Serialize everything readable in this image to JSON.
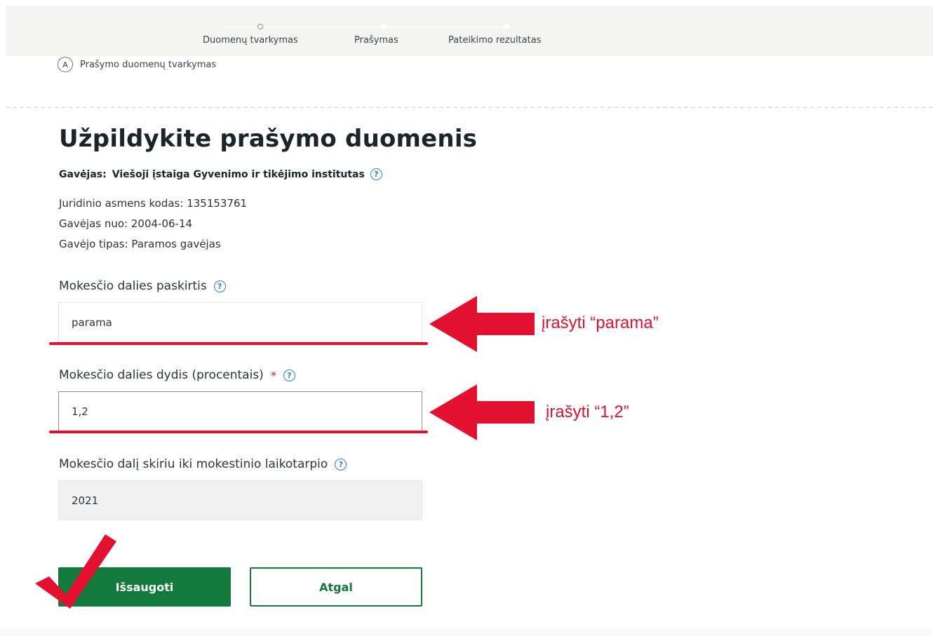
{
  "stepper": {
    "steps": [
      {
        "label": "Duomenų tvarkymas",
        "state": "current"
      },
      {
        "label": "Prašymas",
        "state": "upcoming"
      },
      {
        "label": "Pateikimo rezultatas",
        "state": "upcoming"
      }
    ],
    "sub_step": {
      "letter": "A",
      "label": "Prašymo duomenų tvarkymas"
    }
  },
  "page": {
    "title": "Užpildykite prašymo duomenis",
    "recipient_label": "Gavėjas:",
    "recipient_name": "Viešoji įstaiga Gyvenimo ir tikėjimo institutas",
    "info": {
      "code": "Juridinio asmens kodas: 135153761",
      "since": "Gavėjas nuo: 2004-06-14",
      "type": "Gavėjo tipas: Paramos gavėjas"
    }
  },
  "form": {
    "purpose": {
      "label": "Mokesčio dalies paskirtis",
      "value": "parama"
    },
    "percent": {
      "label": "Mokesčio dalies dydis (procentais)",
      "required_mark": "*",
      "value": "1,2"
    },
    "until": {
      "label": "Mokesčio dalį skiriu iki mokestinio laikotarpio",
      "value": "2021"
    }
  },
  "buttons": {
    "save": "Išsaugoti",
    "back": "Atgal"
  },
  "annotations": {
    "purpose_hint": "įrašyti “parama”",
    "percent_hint": "įrašyti “1,2”"
  },
  "colors": {
    "primary_green": "#117a3c",
    "annotation_red": "#e3102f",
    "help_blue": "#2b7fc4"
  }
}
